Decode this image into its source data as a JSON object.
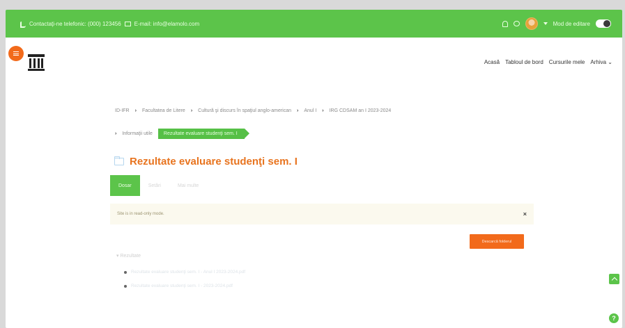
{
  "topbar": {
    "phone_label": "Contactaţi-ne telefonic: (000) 123456",
    "email_label": "E-mail: info@elamolo.com",
    "mode_label": "Mod de editare"
  },
  "nav": {
    "items": [
      "Acasă",
      "Tabloul de bord",
      "Cursurile mele",
      "Arhiva"
    ]
  },
  "breadcrumb": {
    "items": [
      "ID-IFR",
      "Facultatea de Litere",
      "Cultură şi discurs în spaţiul anglo-american",
      "Anul I",
      "IRG CDSAM an I 2023-2024"
    ],
    "row2_items": [
      "Informaţii utile"
    ],
    "active": "Rezultate evaluare studenţi sem. I"
  },
  "page": {
    "title": "Rezultate evaluare studenţi sem. I"
  },
  "tabs": [
    "Dosar",
    "Setări",
    "Mai multe"
  ],
  "alert": {
    "text": "Site is in read-only mode.",
    "close": "×"
  },
  "download_button": "Descarcă folderul",
  "tree": {
    "root": "Rezultate",
    "files": [
      "Rezultate evaluare studenţi sem. I - Anul I 2023-2024.pdf",
      "Rezultate evaluare studenţi sem. I - 2023-2024.pdf"
    ]
  },
  "help": "?",
  "colors": {
    "green": "#5cc44a",
    "orange": "#f26a1b",
    "title_orange": "#e8741f"
  },
  "icons": {
    "phone": "phone-icon",
    "mail": "mail-icon",
    "bell": "bell-icon",
    "chat": "chat-icon",
    "drawer": "hamburger-icon",
    "folder": "folder-icon",
    "back_to_top": "chevron-up-icon"
  }
}
